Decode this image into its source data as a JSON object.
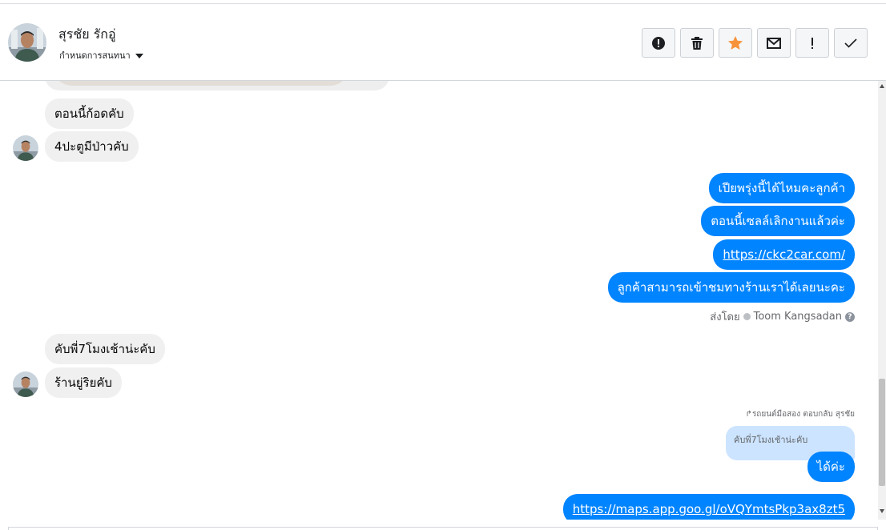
{
  "header": {
    "contact_name": "สุรชัย รักอู่",
    "conversation_settings": "กำหนดการสนทนา",
    "toolbar": [
      {
        "name": "report-spam-button",
        "icon": "alert-circle-icon"
      },
      {
        "name": "delete-button",
        "icon": "trash-icon"
      },
      {
        "name": "star-button",
        "icon": "star-icon"
      },
      {
        "name": "mark-unread-button",
        "icon": "envelope-icon"
      },
      {
        "name": "follow-up-button",
        "icon": "exclamation-icon"
      },
      {
        "name": "mark-done-button",
        "icon": "checkmark-icon"
      }
    ]
  },
  "colors": {
    "outgoing_bubble": "#0084ff",
    "incoming_bubble": "#f0f0f0",
    "quote_bubble": "#cce4ff",
    "star": "#f7923a"
  },
  "messages": {
    "in_1": "ตอนนี้ก้อดคับ",
    "in_2": "4ปะตูมีป่าวคับ",
    "out_1": "เปียพรุ่งนี้ได้ไหมคะลูกค้า",
    "out_2": "ตอนนี้เซลล์เลิกงานแล้วค่ะ",
    "out_3": "https://ckc2car.com/",
    "out_4": "ลูกค้าสามารถเข้าชมทางร้านเราได้เลยนะคะ",
    "sent_by_label": "ส่งโดย",
    "sent_by_name": "Toom Kangsadan",
    "in_3": "คับพี่7โมงเช้าน่ะคับ",
    "in_4": "ร้านยู่ริยคับ",
    "reply_context": "รถยนต์มือสอง ตอบกลับ สุรชัย",
    "quoted_text": "คับพี่7โมงเช้าน่ะคับ",
    "out_5": "ได้ค่ะ",
    "out_6": "https://maps.app.goo.gl/oVQYmtsPkp3ax8zt5"
  }
}
